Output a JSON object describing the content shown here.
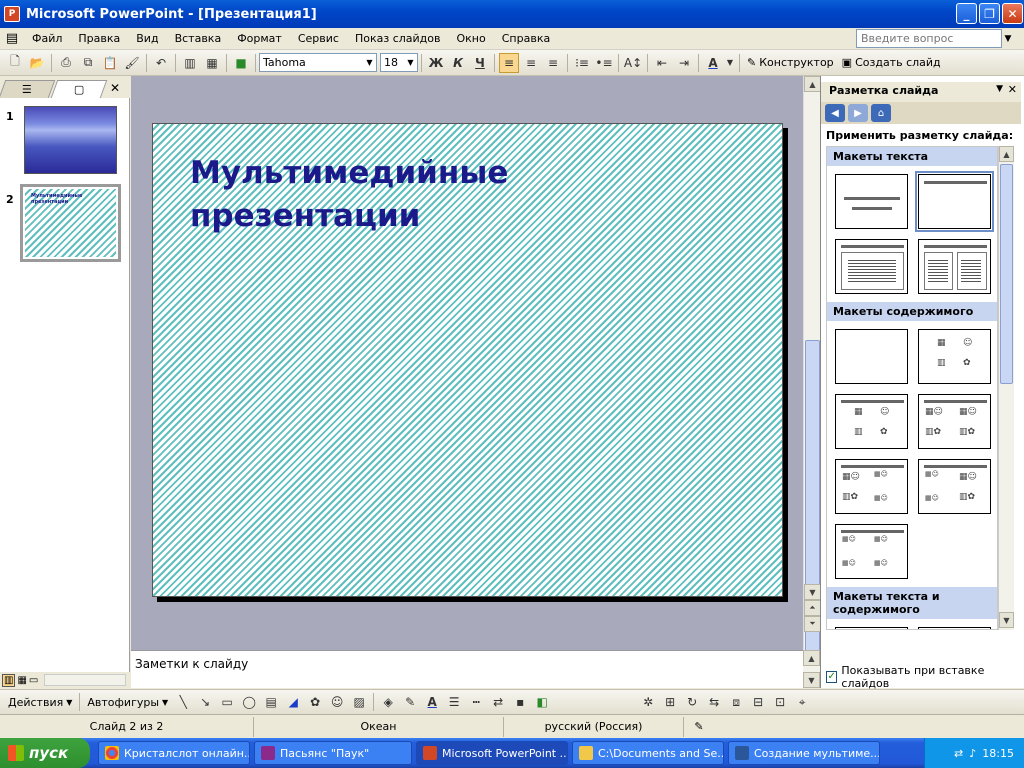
{
  "window": {
    "title": "Microsoft PowerPoint - [Презентация1]"
  },
  "menu": {
    "items": [
      "Файл",
      "Правка",
      "Вид",
      "Вставка",
      "Формат",
      "Сервис",
      "Показ слайдов",
      "Окно",
      "Справка"
    ],
    "help_placeholder": "Введите вопрос"
  },
  "toolbar": {
    "font": "Tahoma",
    "size": "18",
    "bold": "Ж",
    "italic": "К",
    "underline": "Ч",
    "designer": "Конструктор",
    "new_slide": "Создать слайд"
  },
  "slides": {
    "num1": "1",
    "num2": "2",
    "thumb2_title": "Мультимедийные презентации"
  },
  "slide": {
    "title": "Мультимедийные презентации"
  },
  "notes": {
    "placeholder": "Заметки к слайду"
  },
  "taskpane": {
    "title": "Разметка слайда",
    "apply_label": "Применить разметку слайда:",
    "sec_text": "Макеты текста",
    "sec_content": "Макеты содержимого",
    "sec_text_content": "Макеты текста и содержимого",
    "show_on_insert": "Показывать при вставке слайдов"
  },
  "drawbar": {
    "actions": "Действия",
    "autoshapes": "Автофигуры"
  },
  "status": {
    "slide": "Слайд 2 из 2",
    "design": "Океан",
    "language": "русский (Россия)"
  },
  "taskbar": {
    "start": "пуск",
    "tasks": [
      "Кристалслот онлайн...",
      "Пасьянс \"Паук\"",
      "Microsoft PowerPoint ...",
      "C:\\Documents and Se...",
      "Создание мультиме..."
    ],
    "time": "18:15"
  },
  "colors": {
    "title_text": "#1a1a8a",
    "stripe": "#5fbfbf",
    "titlebar": "#0047c8"
  }
}
